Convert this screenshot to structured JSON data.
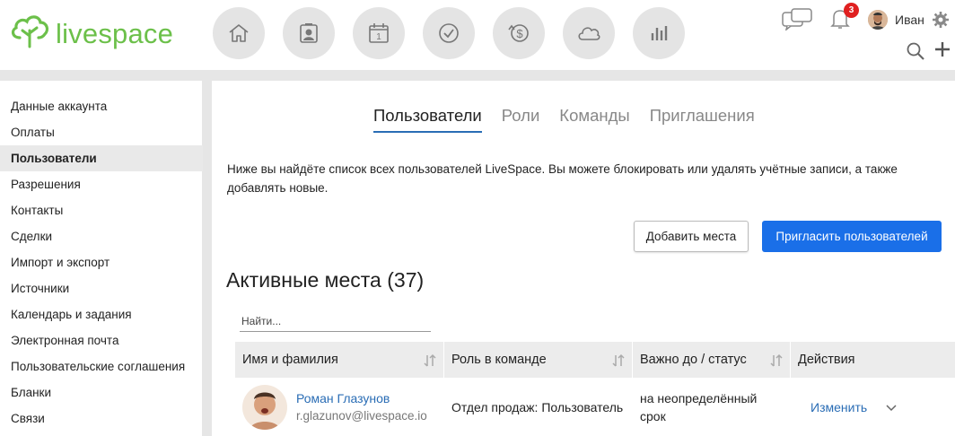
{
  "header": {
    "logo_text": "livespace",
    "nav_icons": [
      "home-icon",
      "contacts-icon",
      "calendar-icon",
      "tasks-icon",
      "deals-icon",
      "cloud-icon",
      "reports-icon"
    ],
    "calendar_day": "1",
    "notification_count": "3",
    "user_name": "Иван"
  },
  "sidebar": {
    "items": [
      {
        "label": "Данные аккаунта"
      },
      {
        "label": "Оплаты"
      },
      {
        "label": "Пользователи"
      },
      {
        "label": "Разрешения"
      },
      {
        "label": "Контакты"
      },
      {
        "label": "Сделки"
      },
      {
        "label": "Импорт и экспорт"
      },
      {
        "label": "Источники"
      },
      {
        "label": "Календарь и задания"
      },
      {
        "label": "Электронная почта"
      },
      {
        "label": "Пользовательские соглашения"
      },
      {
        "label": "Бланки"
      },
      {
        "label": "Связи"
      }
    ],
    "active_index": 2
  },
  "main": {
    "tabs": [
      {
        "label": "Пользователи"
      },
      {
        "label": "Роли"
      },
      {
        "label": "Команды"
      },
      {
        "label": "Приглашения"
      }
    ],
    "description": "Ниже вы найдёте список всех пользователей LiveSpace. Вы можете блокировать или удалять учётные записи, а также добавлять новые.",
    "add_seats_label": "Добавить места",
    "invite_label": "Пригласить пользователей",
    "section_title": "Активные места (37)",
    "search_placeholder": "Найти...",
    "table": {
      "columns": [
        "Имя и фамилия",
        "Роль в команде",
        "Важно до / статус",
        "Действия"
      ],
      "rows": [
        {
          "name": "Роман Глазунов",
          "email": "r.glazunov@livespace.io",
          "role": "Отдел продаж: Пользователь",
          "status": "на неопределённый срок",
          "action": "Изменить"
        }
      ]
    }
  },
  "colors": {
    "brand_green": "#6cc04a",
    "primary_blue": "#1a6fe8",
    "link_blue": "#2a6db5",
    "badge_red": "#e02020"
  }
}
